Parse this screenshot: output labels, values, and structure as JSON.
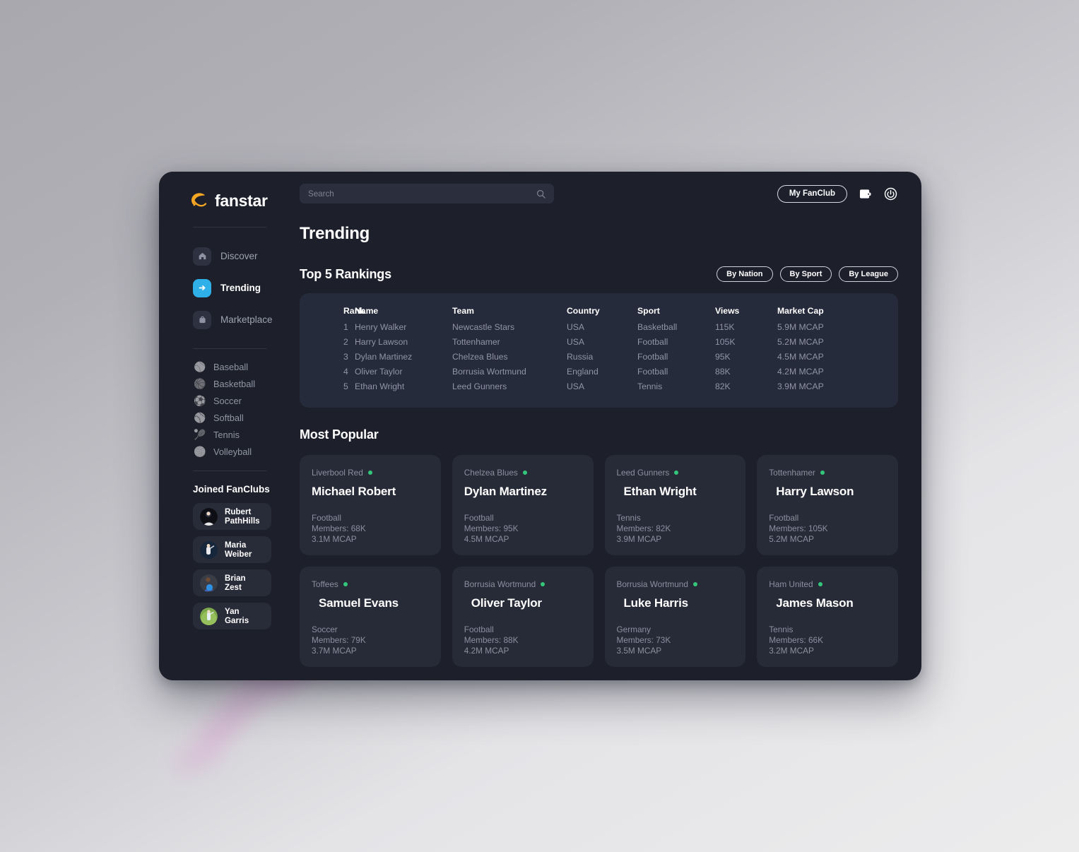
{
  "brand": {
    "name": "fanstar",
    "logo_icon": "swoosh-icon",
    "accent": "#f5a623"
  },
  "search": {
    "value": "",
    "placeholder": "Search",
    "icon": "search-icon"
  },
  "topbar": {
    "my_fanclub_label": "My FanClub",
    "wallet_icon": "wallet-icon",
    "power_icon": "power-icon"
  },
  "sidebar": {
    "nav": [
      {
        "label": "Discover",
        "icon": "home-icon",
        "active": false
      },
      {
        "label": "Trending",
        "icon": "arrow-right-icon",
        "active": true
      },
      {
        "label": "Marketplace",
        "icon": "shopping-bag-icon",
        "active": false
      }
    ],
    "sports": [
      {
        "label": "Baseball",
        "icon": "baseball-icon",
        "glyph": "⚾"
      },
      {
        "label": "Basketball",
        "icon": "basketball-icon",
        "glyph": "🏀"
      },
      {
        "label": "Soccer",
        "icon": "soccer-ball-icon",
        "glyph": "⚽"
      },
      {
        "label": "Softball",
        "icon": "softball-bat-icon",
        "glyph": "🥎"
      },
      {
        "label": "Tennis",
        "icon": "tennis-racket-icon",
        "glyph": "🎾"
      },
      {
        "label": "Volleyball",
        "icon": "volleyball-icon",
        "glyph": "🏐"
      }
    ],
    "fanclubs_title": "Joined FanClubs",
    "fanclubs": [
      {
        "name": "Rubert PathHills",
        "avatar": "avatar-rubert-pathhills"
      },
      {
        "name": "Maria Weiber",
        "avatar": "avatar-maria-weiber"
      },
      {
        "name": "Brian Zest",
        "avatar": "avatar-brian-zest"
      },
      {
        "name": "Yan Garris",
        "avatar": "avatar-yan-garris"
      }
    ]
  },
  "main": {
    "page_title": "Trending",
    "rankings": {
      "title": "Top 5 Rankings",
      "filters": [
        "By Nation",
        "By Sport",
        "By League"
      ],
      "columns": [
        "Rank",
        "Name",
        "Team",
        "Country",
        "Sport",
        "Views",
        "Market Cap"
      ],
      "rows": [
        [
          "1",
          "Henry Walker",
          "Newcastle Stars",
          "USA",
          "Basketball",
          "115K",
          "5.9M MCAP"
        ],
        [
          "2",
          "Harry Lawson",
          "Tottenhamer",
          "USA",
          "Football",
          "105K",
          "5.2M MCAP"
        ],
        [
          "3",
          "Dylan Martinez",
          "Chelzea Blues",
          "Russia",
          "Football",
          "95K",
          "4.5M MCAP"
        ],
        [
          "4",
          "Oliver Taylor",
          "Borrusia Wortmund",
          "England",
          "Football",
          "88K",
          "4.2M MCAP"
        ],
        [
          "5",
          "Ethan Wright",
          "Leed Gunners",
          "USA",
          "Tennis",
          "82K",
          "3.9M MCAP"
        ]
      ]
    },
    "popular": {
      "title": "Most Popular",
      "status_color": "#34c77b",
      "cards": [
        {
          "team": "Liverbool Red",
          "name": "Michael Robert",
          "sport": "Football",
          "members": "Members: 68K",
          "mcap": "3.1M MCAP"
        },
        {
          "team": "Chelzea Blues",
          "name": "Dylan Martinez",
          "sport": "Football",
          "members": "Members: 95K",
          "mcap": "4.5M MCAP"
        },
        {
          "team": "Leed Gunners",
          "name": "Ethan Wright",
          "sport": "Tennis",
          "members": "Members: 82K",
          "mcap": "3.9M MCAP"
        },
        {
          "team": "Tottenhamer",
          "name": "Harry Lawson",
          "sport": "Football",
          "members": "Members: 105K",
          "mcap": "5.2M MCAP"
        },
        {
          "team": "Toffees",
          "name": "Samuel Evans",
          "sport": "Soccer",
          "members": "Members: 79K",
          "mcap": "3.7M MCAP"
        },
        {
          "team": "Borrusia Wortmund",
          "name": "Oliver Taylor",
          "sport": "Football",
          "members": "Members: 88K",
          "mcap": "4.2M MCAP"
        },
        {
          "team": "Borrusia Wortmund",
          "name": "Luke Harris",
          "sport": "Germany",
          "members": "Members: 73K",
          "mcap": "3.5M MCAP"
        },
        {
          "team": "Ham United",
          "name": "James Mason",
          "sport": "Tennis",
          "members": "Members: 66K",
          "mcap": "3.2M MCAP"
        }
      ]
    }
  }
}
